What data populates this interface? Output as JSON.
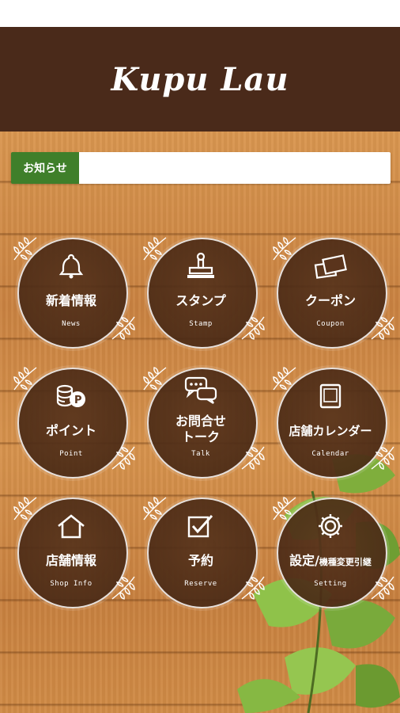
{
  "app": {
    "title": "Kupu Lau"
  },
  "notice": {
    "label": "お知らせ",
    "text": ""
  },
  "menu": [
    {
      "label": "新着情報",
      "sub": "News",
      "icon": "bell-icon"
    },
    {
      "label": "スタンプ",
      "sub": "Stamp",
      "icon": "stamp-icon"
    },
    {
      "label": "クーポン",
      "sub": "Coupon",
      "icon": "coupon-icon"
    },
    {
      "label": "ポイント",
      "sub": "Point",
      "icon": "point-coins-icon"
    },
    {
      "label_line1": "お問合せ",
      "label_line2": "トーク",
      "sub": "Talk",
      "icon": "chat-bubbles-icon"
    },
    {
      "label": "店舗カレンダー",
      "sub": "Calendar",
      "icon": "calendar-icon"
    },
    {
      "label": "店舗情報",
      "sub": "Shop Info",
      "icon": "house-icon"
    },
    {
      "label": "予約",
      "sub": "Reserve",
      "icon": "checkbox-icon"
    },
    {
      "label_main": "設定/",
      "label_small": "機種変更引継",
      "sub": "Setting",
      "icon": "gear-icon"
    }
  ],
  "colors": {
    "header": "#4a2a1a",
    "notice_label": "#3f7f2a",
    "circle": "#5a341c"
  }
}
